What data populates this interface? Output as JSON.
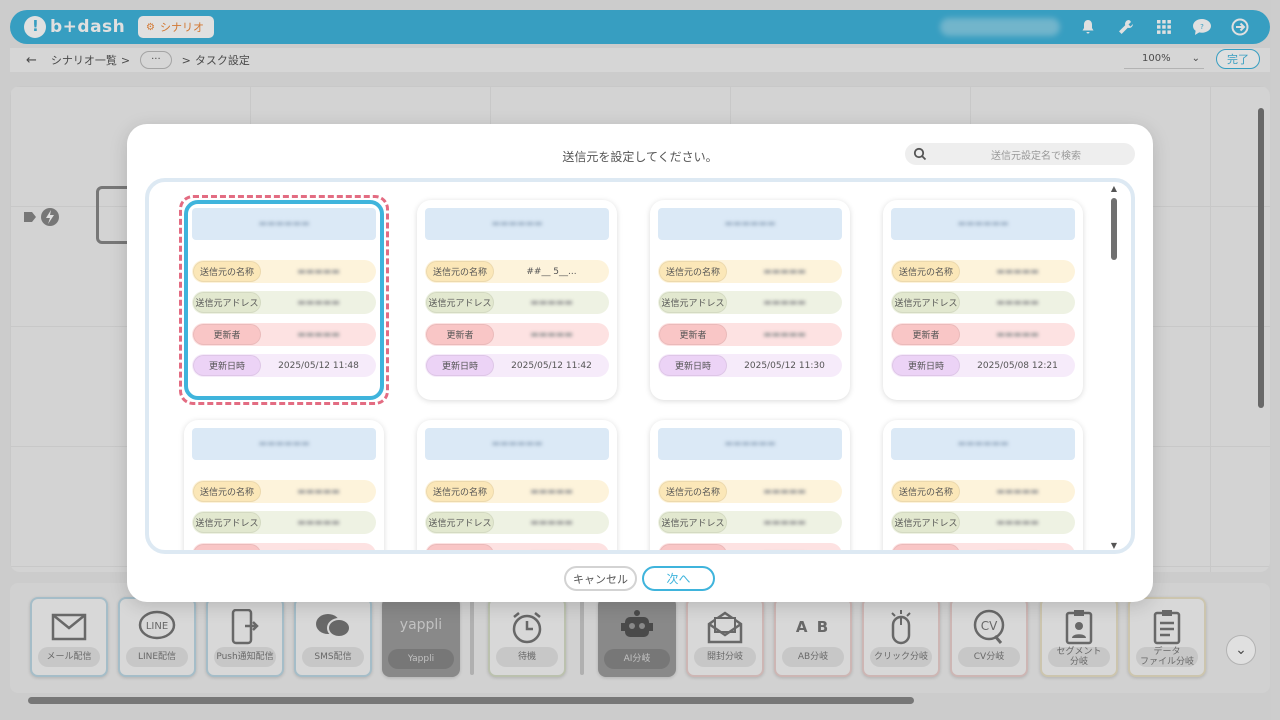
{
  "header": {
    "logo_text": "b+dash",
    "scenario_label": "シナリオ"
  },
  "breadcrumb": {
    "back": "←",
    "scenario_list": "シナリオ一覧",
    "sep1": ">",
    "more": "···",
    "sep2": ">",
    "current": "タスク設定"
  },
  "toolbar": {
    "zoom_value": "100%",
    "done_label": "完了"
  },
  "modal": {
    "title": "送信元を設定してください。",
    "search_placeholder": "送信元設定名で検索",
    "cancel_label": "キャンセル",
    "next_label": "次へ",
    "labels": {
      "name": "送信元の名称",
      "address": "送信元アドレス",
      "updater": "更新者",
      "updated_at": "更新日時"
    },
    "cards": [
      {
        "updated_at": "2025/05/12 11:48",
        "name_value": "",
        "selected": true
      },
      {
        "updated_at": "2025/05/12 11:42",
        "name_value": "##__ 5__..."
      },
      {
        "updated_at": "2025/05/12 11:30",
        "name_value": ""
      },
      {
        "updated_at": "2025/05/08 12:21",
        "name_value": ""
      },
      {
        "updated_at": "",
        "name_value": ""
      },
      {
        "updated_at": "",
        "name_value": ""
      },
      {
        "updated_at": "",
        "name_value": ""
      },
      {
        "updated_at": "",
        "name_value": ""
      }
    ]
  },
  "palette": {
    "items": [
      {
        "label": "メール配信",
        "icon": "mail-icon"
      },
      {
        "label": "LINE配信",
        "icon": "line-icon"
      },
      {
        "label": "Push通知配信",
        "icon": "push-icon"
      },
      {
        "label": "SMS配信",
        "icon": "sms-icon"
      },
      {
        "label": "Yappli",
        "icon": "yappli-icon",
        "icon_text": "yappli"
      },
      {
        "label": "待機",
        "icon": "alarm-icon"
      },
      {
        "label": "AI分岐",
        "icon": "robot-icon"
      },
      {
        "label": "開封分岐",
        "icon": "open-mail-icon"
      },
      {
        "label": "AB分岐",
        "icon": "ab-icon",
        "icon_text": "A B"
      },
      {
        "label": "クリック分岐",
        "icon": "mouse-icon"
      },
      {
        "label": "CV分岐",
        "icon": "cv-icon",
        "icon_text": "CV"
      },
      {
        "label": "セグメント\n分岐",
        "icon": "segment-icon"
      },
      {
        "label": "データ\nファイル分岐",
        "icon": "datafile-icon"
      }
    ]
  },
  "colors": {
    "accent": "#3fb4dc",
    "selection_dash": "#e36c82"
  }
}
